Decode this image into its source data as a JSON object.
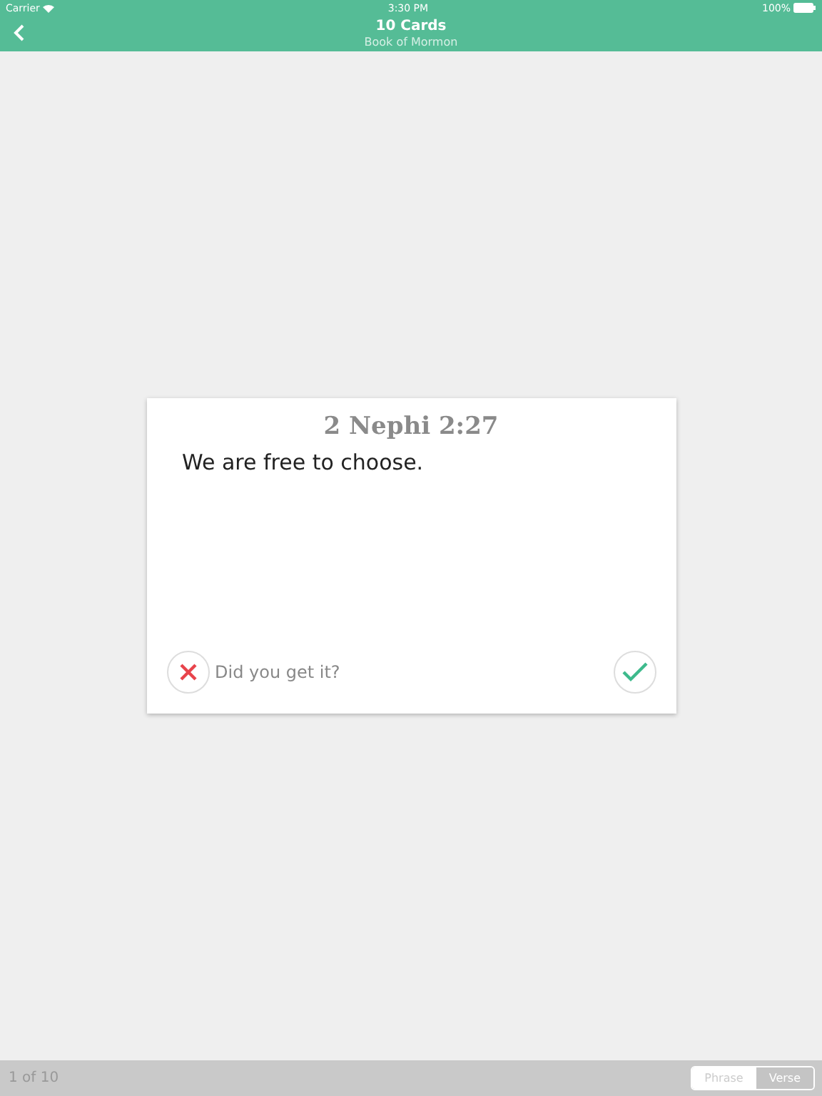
{
  "status_bar": {
    "carrier": "Carrier",
    "time": "3:30 PM",
    "battery": "100%"
  },
  "nav_bar": {
    "title": "10 Cards",
    "subtitle": "Book of Mormon"
  },
  "card": {
    "reference": "2 Nephi 2:27",
    "text": "We are free to choose.",
    "prompt": "Did you get it?"
  },
  "footer": {
    "progress": "1 of 10",
    "modes": [
      {
        "label": "Phrase",
        "selected": false
      },
      {
        "label": "Verse",
        "selected": true
      }
    ]
  }
}
